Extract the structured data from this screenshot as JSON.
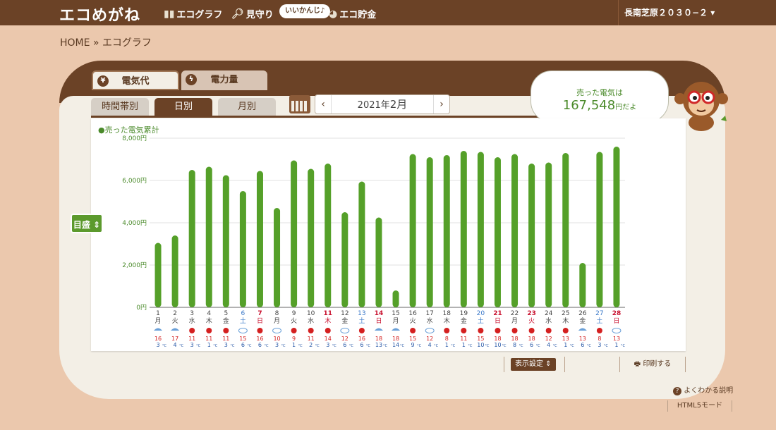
{
  "app": {
    "logo": "エコめがね",
    "nav": [
      "エコグラフ",
      "見守り",
      "エコ貯金"
    ],
    "bubble": "いいかんじ♪",
    "user": "長南芝原２０３０−２"
  },
  "breadcrumb": "HOME » エコグラフ",
  "type_tabs": [
    {
      "label": "電気代",
      "icon": "yen-icon"
    },
    {
      "label": "電力量",
      "icon": "lightning-icon"
    }
  ],
  "period_tabs": [
    "時間帯別",
    "日別",
    "月別"
  ],
  "date_nav": {
    "prefix": "2021年",
    "month": "2月",
    "prev": "‹",
    "next": "›"
  },
  "sold": {
    "label": "売った電気は",
    "amount": "167,548",
    "unit": "円だよ"
  },
  "gauge_button": "目盛",
  "bottom": {
    "display_settings": "表示設定",
    "print": "印刷する",
    "help": "よくわかる説明",
    "html5": "HTML5モード"
  },
  "colors": {
    "bar": "#55a029",
    "brown": "#6b4226",
    "saturday": "#3a78c8",
    "holiday": "#c8102e"
  },
  "chart_data": {
    "type": "bar",
    "legend": "●売った電気累計",
    "ylim": [
      0,
      8000
    ],
    "yticks": [
      "0円",
      "2,000円",
      "4,000円",
      "6,000円",
      "8,000円"
    ],
    "grid": true,
    "categories": [
      "1",
      "2",
      "3",
      "4",
      "5",
      "6",
      "7",
      "8",
      "9",
      "10",
      "11",
      "12",
      "13",
      "14",
      "15",
      "16",
      "17",
      "18",
      "19",
      "20",
      "21",
      "22",
      "23",
      "24",
      "25",
      "26",
      "27",
      "28"
    ],
    "weekdays": [
      "月",
      "火",
      "水",
      "木",
      "金",
      "土",
      "日",
      "月",
      "火",
      "水",
      "木",
      "金",
      "土",
      "日",
      "月",
      "火",
      "水",
      "木",
      "金",
      "土",
      "日",
      "月",
      "火",
      "水",
      "木",
      "金",
      "土",
      "日"
    ],
    "day_types": [
      "w",
      "w",
      "w",
      "w",
      "w",
      "sat",
      "hol",
      "w",
      "w",
      "w",
      "hol",
      "w",
      "sat",
      "hol",
      "w",
      "w",
      "w",
      "w",
      "w",
      "sat",
      "hol",
      "w",
      "hol",
      "w",
      "w",
      "w",
      "sat",
      "hol"
    ],
    "values": [
      3050,
      3400,
      6500,
      6650,
      6250,
      5500,
      6450,
      4700,
      6950,
      6550,
      6800,
      4500,
      5950,
      4250,
      800,
      7250,
      7100,
      7200,
      7400,
      7350,
      7100,
      7250,
      6800,
      6850,
      7300,
      2100,
      7350,
      7600
    ],
    "weather": [
      "rain",
      "rain",
      "sun",
      "sun",
      "sun",
      "cloud",
      "sun",
      "cloud",
      "sun",
      "sun",
      "sun",
      "cloud",
      "sun",
      "rain",
      "rain",
      "sun",
      "cloud",
      "sun",
      "sun",
      "sun",
      "sun",
      "sun",
      "sun",
      "sun",
      "sun",
      "rain",
      "sun",
      "cloud"
    ],
    "temp_high": [
      "16",
      "17",
      "11",
      "11",
      "11",
      "15",
      "16",
      "10",
      "9",
      "11",
      "14",
      "12",
      "16",
      "18",
      "18",
      "15",
      "12",
      "8",
      "11",
      "15",
      "18",
      "18",
      "18",
      "12",
      "13",
      "13",
      "8",
      "13"
    ],
    "temp_low": [
      "3",
      "4",
      "3",
      "1",
      "3",
      "6",
      "6",
      "3",
      "1",
      "2",
      "3",
      "6",
      "6",
      "13",
      "14",
      "9",
      "4",
      "1",
      "1",
      "10",
      "10",
      "8",
      "6",
      "4",
      "1",
      "6",
      "3",
      "1"
    ],
    "temp_unit": "°C"
  }
}
